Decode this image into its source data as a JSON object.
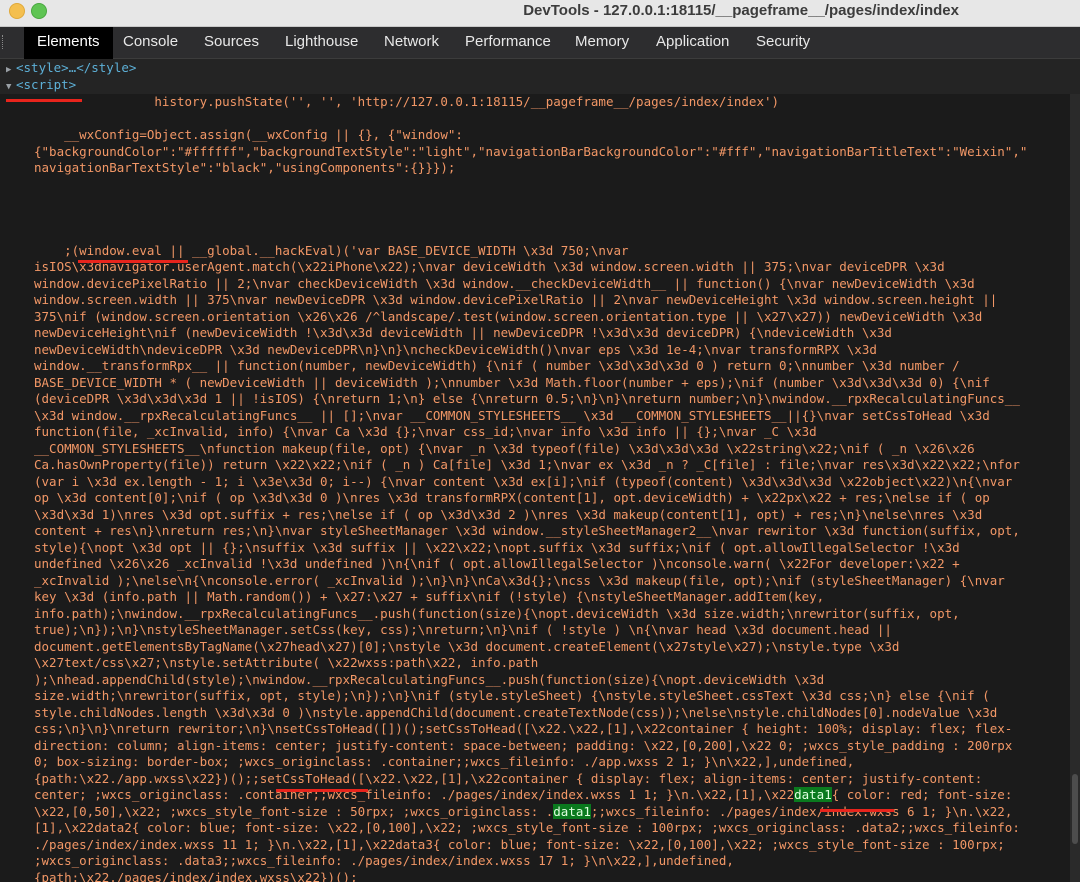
{
  "window": {
    "title": "DevTools - 127.0.0.1:18115/__pageframe__/pages/index/index"
  },
  "tabs": [
    {
      "label": "Elements",
      "active": true
    },
    {
      "label": "Console"
    },
    {
      "label": "Sources"
    },
    {
      "label": "Lighthouse"
    },
    {
      "label": "Network"
    },
    {
      "label": "Performance"
    },
    {
      "label": "Memory"
    },
    {
      "label": "Application"
    },
    {
      "label": "Security"
    }
  ],
  "dom": {
    "style_node": "<style>…</style>",
    "script_node": "<script>"
  },
  "code": {
    "history_line": "                history.pushState('', '', 'http://127.0.0.1:18115/__pageframe__/pages/index/index')",
    "wxconfig_lines": [
      "    __wxConfig=Object.assign(__wxConfig || {}, {\"window\":",
      "{\"backgroundColor\":\"#ffffff\",\"backgroundTextStyle\":\"light\",\"navigationBarBackgroundColor\":\"#fff\",\"navigationBarTitleText\":\"Weixin\",\"",
      "navigationBarTextStyle\":\"black\",\"usingComponents\":{}}});"
    ],
    "eval_lines": [
      "    ;(window.eval || __global.__hackEval)('var BASE_DEVICE_WIDTH \\x3d 750;\\nvar",
      "isIOS\\x3dnavigator.userAgent.match(\\x22iPhone\\x22);\\nvar deviceWidth \\x3d window.screen.width || 375;\\nvar deviceDPR \\x3d",
      "window.devicePixelRatio || 2;\\nvar checkDeviceWidth \\x3d window.__checkDeviceWidth__ || function() {\\nvar newDeviceWidth \\x3d",
      "window.screen.width || 375\\nvar newDeviceDPR \\x3d window.devicePixelRatio || 2\\nvar newDeviceHeight \\x3d window.screen.height ||",
      "375\\nif (window.screen.orientation \\x26\\x26 /^landscape/.test(window.screen.orientation.type || \\x27\\x27)) newDeviceWidth \\x3d",
      "newDeviceHeight\\nif (newDeviceWidth !\\x3d\\x3d deviceWidth || newDeviceDPR !\\x3d\\x3d deviceDPR) {\\ndeviceWidth \\x3d",
      "newDeviceWidth\\ndeviceDPR \\x3d newDeviceDPR\\n}\\n}\\ncheckDeviceWidth()\\nvar eps \\x3d 1e-4;\\nvar transformRPX \\x3d",
      "window.__transformRpx__ || function(number, newDeviceWidth) {\\nif ( number \\x3d\\x3d\\x3d 0 ) return 0;\\nnumber \\x3d number /",
      "BASE_DEVICE_WIDTH * ( newDeviceWidth || deviceWidth );\\nnumber \\x3d Math.floor(number + eps);\\nif (number \\x3d\\x3d\\x3d 0) {\\nif",
      "(deviceDPR \\x3d\\x3d\\x3d 1 || !isIOS) {\\nreturn 1;\\n} else {\\nreturn 0.5;\\n}\\n}\\nreturn number;\\n}\\nwindow.__rpxRecalculatingFuncs__",
      "\\x3d window.__rpxRecalculatingFuncs__ || [];\\nvar __COMMON_STYLESHEETS__ \\x3d __COMMON_STYLESHEETS__||{}\\nvar setCssToHead \\x3d",
      "function(file, _xcInvalid, info) {\\nvar Ca \\x3d {};\\nvar css_id;\\nvar info \\x3d info || {};\\nvar _C \\x3d",
      "__COMMON_STYLESHEETS__\\nfunction makeup(file, opt) {\\nvar _n \\x3d typeof(file) \\x3d\\x3d\\x3d \\x22string\\x22;\\nif ( _n \\x26\\x26",
      "Ca.hasOwnProperty(file)) return \\x22\\x22;\\nif ( _n ) Ca[file] \\x3d 1;\\nvar ex \\x3d _n ? _C[file] : file;\\nvar res\\x3d\\x22\\x22;\\nfor",
      "(var i \\x3d ex.length - 1; i \\x3e\\x3d 0; i--) {\\nvar content \\x3d ex[i];\\nif (typeof(content) \\x3d\\x3d\\x3d \\x22object\\x22)\\n{\\nvar",
      "op \\x3d content[0];\\nif ( op \\x3d\\x3d 0 )\\nres \\x3d transformRPX(content[1], opt.deviceWidth) + \\x22px\\x22 + res;\\nelse if ( op",
      "\\x3d\\x3d 1)\\nres \\x3d opt.suffix + res;\\nelse if ( op \\x3d\\x3d 2 )\\nres \\x3d makeup(content[1], opt) + res;\\n}\\nelse\\nres \\x3d",
      "content + res\\n}\\nreturn res;\\n}\\nvar styleSheetManager \\x3d window.__styleSheetManager2__\\nvar rewritor \\x3d function(suffix, opt,",
      "style){\\nopt \\x3d opt || {};\\nsuffix \\x3d suffix || \\x22\\x22;\\nopt.suffix \\x3d suffix;\\nif ( opt.allowIllegalSelector !\\x3d",
      "undefined \\x26\\x26 _xcInvalid !\\x3d undefined )\\n{\\nif ( opt.allowIllegalSelector )\\nconsole.warn( \\x22For developer:\\x22 +",
      "_xcInvalid );\\nelse\\n{\\nconsole.error( _xcInvalid );\\n}\\n}\\nCa\\x3d{};\\ncss \\x3d makeup(file, opt);\\nif (styleSheetManager) {\\nvar",
      "key \\x3d (info.path || Math.random()) + \\x27:\\x27 + suffix\\nif (!style) {\\nstyleSheetManager.addItem(key,",
      "info.path);\\nwindow.__rpxRecalculatingFuncs__.push(function(size){\\nopt.deviceWidth \\x3d size.width;\\nrewritor(suffix, opt,",
      "true);\\n});\\n}\\nstyleSheetManager.setCss(key, css);\\nreturn;\\n}\\nif ( !style ) \\n{\\nvar head \\x3d document.head ||",
      "document.getElementsByTagName(\\x27head\\x27)[0];\\nstyle \\x3d document.createElement(\\x27style\\x27);\\nstyle.type \\x3d",
      "\\x27text/css\\x27;\\nstyle.setAttribute( \\x22wxss:path\\x22, info.path",
      ");\\nhead.appendChild(style);\\nwindow.__rpxRecalculatingFuncs__.push(function(size){\\nopt.deviceWidth \\x3d",
      "size.width;\\nrewritor(suffix, opt, style);\\n});\\n}\\nif (style.styleSheet) {\\nstyle.styleSheet.cssText \\x3d css;\\n} else {\\nif (",
      "style.childNodes.length \\x3d\\x3d 0 )\\nstyle.appendChild(document.createTextNode(css));\\nelse\\nstyle.childNodes[0].nodeValue \\x3d",
      "css;\\n}\\n}\\nreturn rewritor;\\n}\\nsetCssToHead([])();setCssToHead([\\x22.\\x22,[1],\\x22container { height: 100%; display: flex; flex-",
      "direction: column; align-items: center; justify-content: space-between; padding: \\x22,[0,200],\\x22 0; ;wxcs_style_padding : 200rpx",
      "0; box-sizing: border-box; ;wxcs_originclass: .container;;wxcs_fileinfo: ./app.wxss 2 1; }\\n\\x22,],undefined,",
      "{path:\\x22./app.wxss\\x22})();;setCssToHead([\\x22.\\x22,[1],\\x22container { display: flex; align-items: center; justify-content:",
      "center; ;wxcs_originclass: .container;;wxcs_fileinfo: ./pages/index/index.wxss 1 1; }\\n.\\x22,[1],\\x22data1{ color: red; font-size:",
      "\\x22,[0,50],\\x22; ;wxcs_style_font-size : 50rpx; ;wxcs_originclass: .data1;;wxcs_fileinfo: ./pages/index/index.wxss 6 1; }\\n.\\x22,",
      "[1],\\x22data2{ color: blue; font-size: \\x22,[0,100],\\x22; ;wxcs_style_font-size : 100rpx; ;wxcs_originclass: .data2;;wxcs_fileinfo:",
      "./pages/index/index.wxss 11 1; }\\n.\\x22,[1],\\x22data3{ color: blue; font-size: \\x22,[0,100],\\x22; ;wxcs_style_font-size : 100rpx;",
      ";wxcs_originclass: .data3;;wxcs_fileinfo: ./pages/index/index.wxss 17 1; }\\n\\x22,],undefined,",
      "{path:\\x22./pages/index/index.wxss\\x22})();"
    ]
  },
  "colors": {
    "code_text": "#f29766",
    "tag": "#5db0d7",
    "highlight": "#0a7a1e",
    "underline": "#e8241c"
  }
}
